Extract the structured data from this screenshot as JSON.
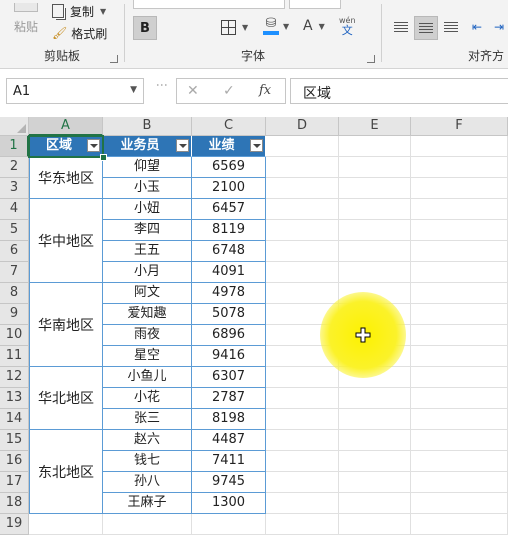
{
  "ribbon": {
    "clipboard": {
      "paste": "粘贴",
      "copy": "复制",
      "format_painter": "格式刷",
      "group_label": "剪贴板"
    },
    "font": {
      "bold": "B",
      "font_color_letter": "A",
      "font_size_letter": "A",
      "phonetic_top": "wén",
      "phonetic_bottom": "文",
      "group_label": "字体"
    },
    "alignment": {
      "group_label": "对齐方"
    }
  },
  "formula_bar": {
    "name_box": "A1",
    "fx": "fx",
    "content": "区域"
  },
  "columns": [
    "A",
    "B",
    "C",
    "D",
    "E",
    "F"
  ],
  "rows": [
    "1",
    "2",
    "3",
    "4",
    "5",
    "6",
    "7",
    "8",
    "9",
    "10",
    "11",
    "12",
    "13",
    "14",
    "15",
    "16",
    "17",
    "18",
    "19"
  ],
  "table": {
    "headers": [
      "区域",
      "业务员",
      "业绩"
    ],
    "groups": [
      {
        "region": "华东地区"
      },
      {
        "region": "华中地区"
      },
      {
        "region": "华南地区"
      },
      {
        "region": "华北地区"
      },
      {
        "region": "东北地区"
      }
    ],
    "records": [
      {
        "name": "仰望",
        "score": "6569"
      },
      {
        "name": "小玉",
        "score": "2100"
      },
      {
        "name": "小妞",
        "score": "6457"
      },
      {
        "name": "李四",
        "score": "8119"
      },
      {
        "name": "王五",
        "score": "6748"
      },
      {
        "name": "小月",
        "score": "4091"
      },
      {
        "name": "阿文",
        "score": "4978"
      },
      {
        "name": "爱知趣",
        "score": "5078"
      },
      {
        "name": "雨夜",
        "score": "6896"
      },
      {
        "name": "星空",
        "score": "9416"
      },
      {
        "name": "小鱼儿",
        "score": "6307"
      },
      {
        "name": "小花",
        "score": "2787"
      },
      {
        "name": "张三",
        "score": "8198"
      },
      {
        "name": "赵六",
        "score": "4487"
      },
      {
        "name": "钱七",
        "score": "7411"
      },
      {
        "name": "孙八",
        "score": "9745"
      },
      {
        "name": "王麻子",
        "score": "1300"
      }
    ]
  },
  "colors": {
    "table_header": "#2e75b6",
    "table_border": "#5b9bd5",
    "selection": "#217346",
    "cursor_highlight": "#fdf200"
  }
}
